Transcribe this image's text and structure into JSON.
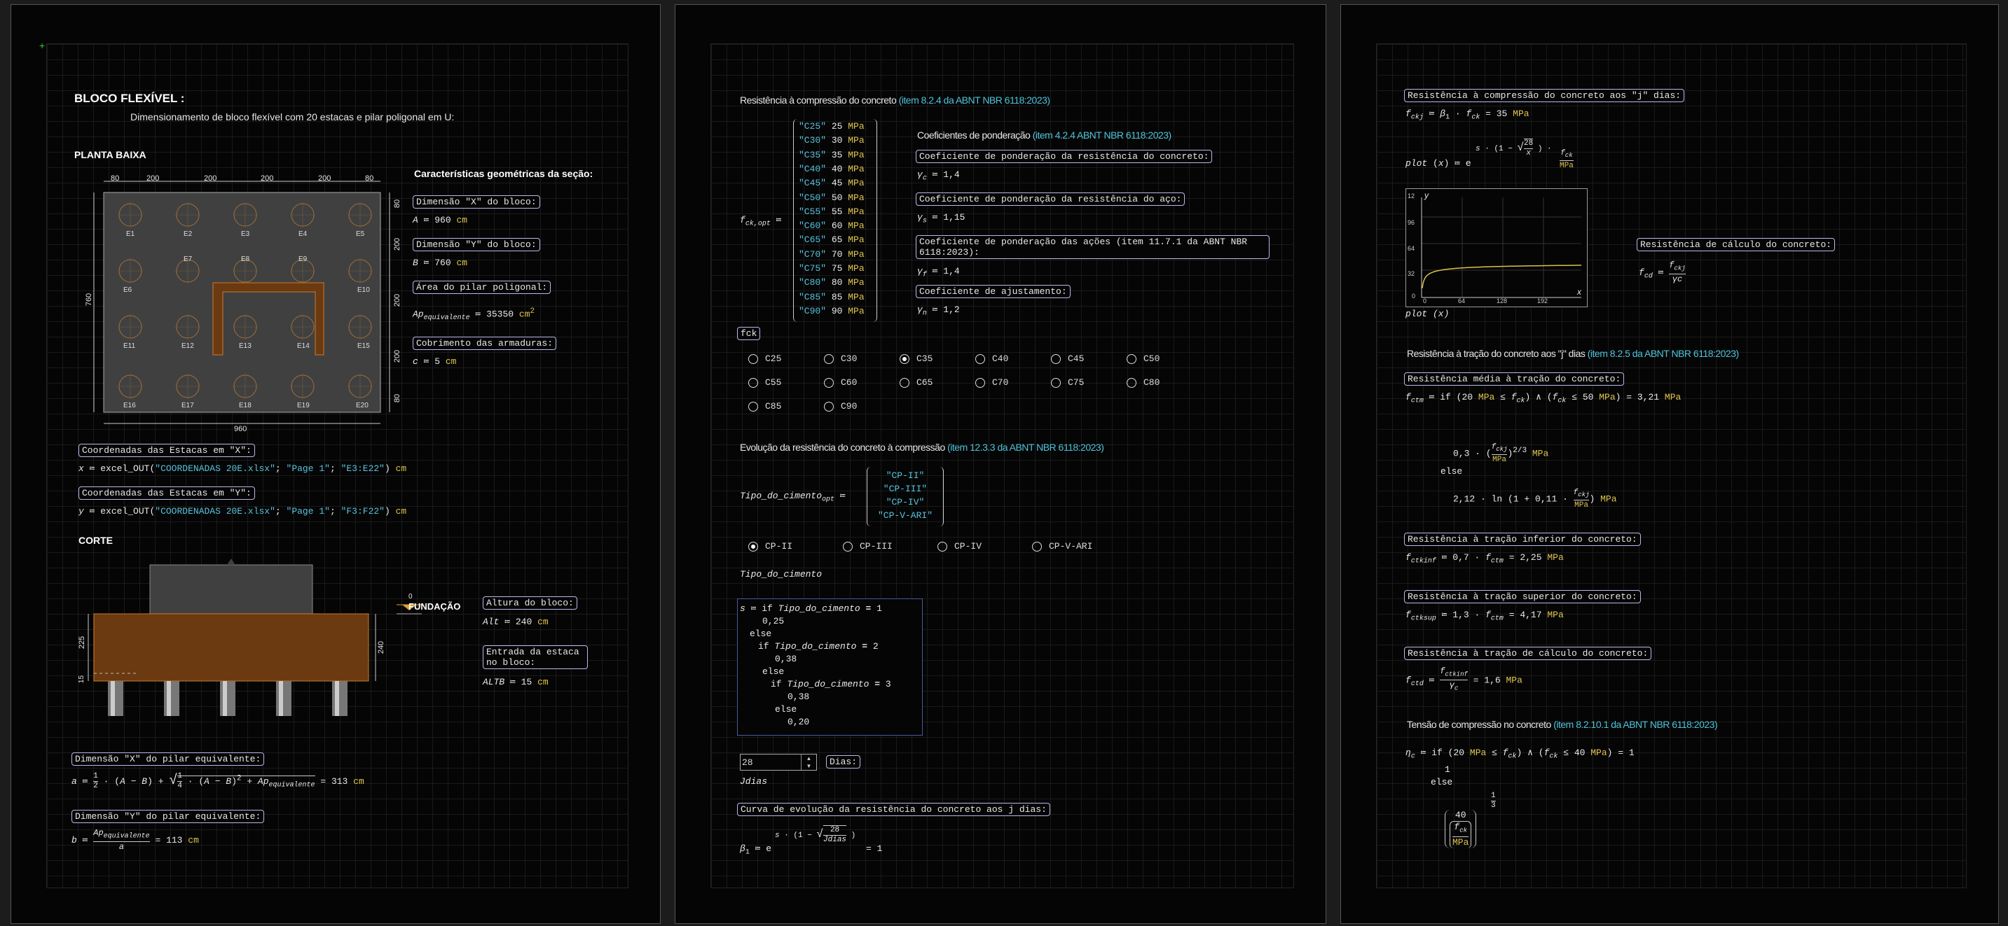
{
  "sheet1": {
    "title": "BLOCO FLEXÍVEL :",
    "subtitle": "Dimensionamento  de bloco flexível com 20 estacas e pilar poligonal  em U:",
    "planta_label": "PLANTA BAIXA",
    "geom_title": "Características geométricas da seção:",
    "plan": {
      "top_dims": [
        "80",
        "200",
        "200",
        "200",
        "200",
        "80"
      ],
      "right_dims": [
        "80",
        "200",
        "200",
        "200",
        "80"
      ],
      "left_dim": "760",
      "bottom_dim": "960",
      "piles": [
        "E1",
        "E2",
        "E3",
        "E4",
        "E5",
        "E6",
        "E7",
        "E8",
        "E9",
        "E10",
        "E11",
        "E12",
        "E13",
        "E14",
        "E15",
        "E16",
        "E17",
        "E18",
        "E19",
        "E20"
      ]
    },
    "dimA_label": "Dimensão \"X\" do bloco:",
    "dimA_var": "A",
    "dimA_val": "960",
    "dimA_unit": "cm",
    "dimB_label": "Dimensão \"Y\" do bloco:",
    "dimB_var": "B",
    "dimB_val": "760",
    "dimB_unit": "cm",
    "area_label": "Área do pilar poligonal:",
    "area_var": "Ap",
    "area_sub": "equivalente",
    "area_val": "35350",
    "area_unit": "cm",
    "area_exp": "2",
    "cob_label": "Cobrimento das armaduras:",
    "cob_var": "c",
    "cob_val": "5",
    "cob_unit": "cm",
    "coordx_label": "Coordenadas das Estacas em \"X\":",
    "coordx_var": "x",
    "coordx_fn": "excel_OUT",
    "coordx_file": "\"COORDENADAS 20E.xlsx\"",
    "coordx_page": "\"Page 1\"",
    "coordx_range": "\"E3:E22\"",
    "coordx_unit": "cm",
    "coordy_label": "Coordenadas das Estacas em \"Y\":",
    "coordy_var": "y",
    "coordy_fn": "excel_OUT",
    "coordy_file": "\"COORDENADAS 20E.xlsx\"",
    "coordy_page": "\"Page 1\"",
    "coordy_range": "\"F3:F22\"",
    "coordy_unit": "cm",
    "corte_label": "CORTE",
    "section": {
      "level": "0",
      "fundacao": "FUNDAÇÃO",
      "d225": "225",
      "d240": "240",
      "d15": "15"
    },
    "alt_label": "Altura do bloco:",
    "alt_var": "Alt",
    "alt_val": "240",
    "alt_unit": "cm",
    "altb_label": "Entrada da estaca no bloco:",
    "altb_var": "ALTB",
    "altb_val": "15",
    "altb_unit": "cm",
    "dimx_label": "Dimensão \"X\" do pilar equivalente:",
    "dimx_var": "a",
    "dimx_result": "313",
    "dimx_unit": "cm",
    "dimy_label": "Dimensão \"Y\" do pilar equivalente:",
    "dimy_var": "b",
    "dimy_result": "113",
    "dimy_unit": "cm",
    "ap_sub": "equivalente"
  },
  "sheet2": {
    "res_title": "Resistência à compressão do concreto ",
    "res_ref": "(item 8.2.4 da ABNT NBR 6118:2023)",
    "fck_var": "f",
    "fck_sub": "ck,opt",
    "fck_list": [
      [
        "\"C25\"",
        "25"
      ],
      [
        "\"C30\"",
        "30"
      ],
      [
        "\"C35\"",
        "35"
      ],
      [
        "\"C40\"",
        "40"
      ],
      [
        "\"C45\"",
        "45"
      ],
      [
        "\"C50\"",
        "50"
      ],
      [
        "\"C55\"",
        "55"
      ],
      [
        "\"C60\"",
        "60"
      ],
      [
        "\"C65\"",
        "65"
      ],
      [
        "\"C70\"",
        "70"
      ],
      [
        "\"C75\"",
        "75"
      ],
      [
        "\"C80\"",
        "80"
      ],
      [
        "\"C85\"",
        "85"
      ],
      [
        "\"C90\"",
        "90"
      ]
    ],
    "mpa": "MPa",
    "coef_title": "Coeficientes de ponderação ",
    "coef_ref": "(item 4.2.4 ABNT NBR 6118:2023)",
    "gc_label": "Coeficiente de ponderação da resistência do concreto:",
    "gc_val": "1,4",
    "gs_label": "Coeficiente de ponderação da resistência do aço:",
    "gs_val": "1,15",
    "gf_label": "Coeficiente de ponderação das ações (item 11.7.1 da ABNT NBR 6118:2023):",
    "gf_val": "1,4",
    "gn_label": "Coeficiente de ajustamento:",
    "gn_val": "1,2",
    "fck_box": "fck",
    "radios": [
      {
        "label": "C25",
        "on": false
      },
      {
        "label": "C30",
        "on": false
      },
      {
        "label": "C35",
        "on": true
      },
      {
        "label": "C40",
        "on": false
      },
      {
        "label": "C45",
        "on": false
      },
      {
        "label": "C50",
        "on": false
      },
      {
        "label": "C55",
        "on": false
      },
      {
        "label": "C60",
        "on": false
      },
      {
        "label": "C65",
        "on": false
      },
      {
        "label": "C70",
        "on": false
      },
      {
        "label": "C75",
        "on": false
      },
      {
        "label": "C80",
        "on": false
      },
      {
        "label": "C85",
        "on": false
      },
      {
        "label": "C90",
        "on": false
      }
    ],
    "evo_title": "Evolução da resistência do concreto à compressão ",
    "evo_ref": "(item 12.3.3 da ABNT NBR 6118:2023)",
    "tipo_var": "Tipo_do_cimento",
    "tipo_sub": "opt",
    "tipo_list": [
      "\"CP-II\"",
      "\"CP-III\"",
      "\"CP-IV\"",
      "\"CP-V-ARI\""
    ],
    "cimento_radios": [
      {
        "label": "CP-II",
        "on": true
      },
      {
        "label": "CP-III",
        "on": false
      },
      {
        "label": "CP-IV",
        "on": false
      },
      {
        "label": "CP-V-ARI",
        "on": false
      }
    ],
    "tipo_line": "Tipo_do_cimento",
    "prog": {
      "l1": "s",
      "l2": "if",
      "l3": "Tipo_do_cimento",
      "eq1": "1",
      "v1": "0,25",
      "else": "else",
      "eq2": "2",
      "v2": "0,38",
      "eq3": "3",
      "v3": "0,38",
      "v4": "0,20"
    },
    "dias_value": "28",
    "dias_label": "Dias:",
    "jdias_var": "Jdias",
    "curva_label": "Curva de evolução da resistência do concreto aos j dias:",
    "beta_num": "28",
    "beta_den": "Jdias",
    "beta_result": "1"
  },
  "sheet3": {
    "fckj_label": "Resistência à compressão do concreto aos \"j\" dias:",
    "fckj_val": "35",
    "plot_fn": "plot",
    "plot_arg": "x",
    "plot_num": "28",
    "plot_den": "x",
    "plot_fck": "f",
    "plot_mpa": "MPa",
    "chart": {
      "yticks": [
        "12",
        "96",
        "64",
        "32",
        "0"
      ],
      "xticks": [
        "0",
        "64",
        "128",
        "192"
      ],
      "ylabel": "y",
      "xlabel": "x",
      "xaxis_label": "plot (x)"
    },
    "fcd_label": "Resistência de cálculo do concreto:",
    "trac_title": "Resistência à tração do concreto aos \"j\" dias ",
    "trac_ref": "(item 8.2.5 da ABNT NBR 6118:2023)",
    "fctm_label": "Resistência média à tração do concreto:",
    "fctm_val": "3,21",
    "fctm_c1": "0,3",
    "fctm_c2": "2,12",
    "fctm_c3": "0,11",
    "fctkinf_label": "Resistência à tração inferior do concreto:",
    "fctkinf_val": "2,25",
    "fctkinf_c": "0,7",
    "fctksup_label": "Resistência à tração superior do concreto:",
    "fctksup_val": "4,17",
    "fctksup_c": "1,3",
    "fctd_label": "Resistência à tração de cálculo do concreto:",
    "fctd_val": "1,6",
    "tens_title": "Tensão de compressão no concreto ",
    "tens_ref": "(item 8.2.10.1 da ABNT NBR 6118:2023)",
    "eta_result": "1",
    "eta_n": "40",
    "eta_exp": "1",
    "eta_3": "3",
    "n20": "20",
    "n50": "50",
    "n40": "40"
  }
}
